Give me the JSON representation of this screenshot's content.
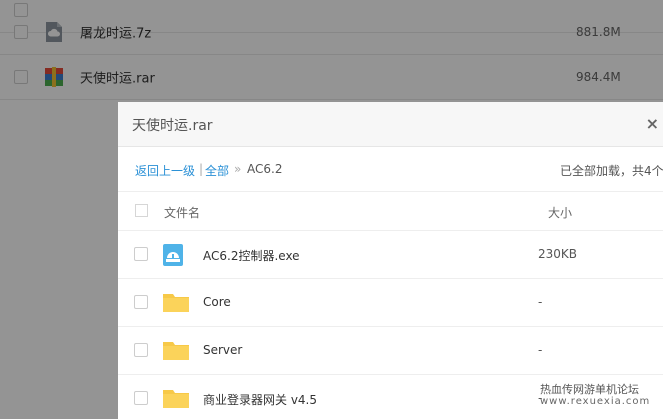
{
  "background_list": {
    "rows": [
      {
        "name": "屠龙时运.7z",
        "size": "881.8M",
        "icon": "cloud-archive-icon"
      },
      {
        "name": "天使时运.rar",
        "size": "984.4M",
        "icon": "rar-archive-icon"
      }
    ]
  },
  "modal": {
    "title": "天使时运.rar",
    "close_label": "×",
    "breadcrumb": {
      "back": "返回上一级",
      "sep1": "|",
      "all": "全部",
      "sep2": "»",
      "current": "AC6.2"
    },
    "status": "已全部加载，共4个",
    "columns": {
      "name": "文件名",
      "size": "大小"
    },
    "files": [
      {
        "name": "AC6.2控制器.exe",
        "size": "230KB",
        "icon": "exe-app-icon"
      },
      {
        "name": "Core",
        "size": "-",
        "icon": "folder-icon"
      },
      {
        "name": "Server",
        "size": "-",
        "icon": "folder-icon"
      },
      {
        "name": "商业登录器网关 v4.5",
        "size": "-",
        "icon": "folder-icon"
      }
    ]
  },
  "watermark": {
    "line1": "热血传网游单机论坛",
    "line2": "www.rexuexia.com"
  },
  "colors": {
    "link": "#2a90d6",
    "folder": "#f7c948",
    "overlay": "rgba(0,0,0,0.42)"
  }
}
